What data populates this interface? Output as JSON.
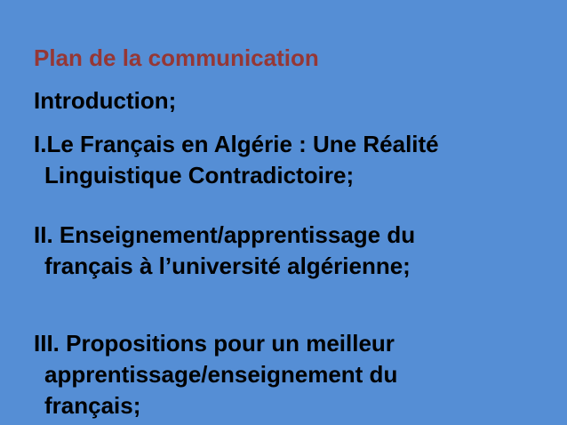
{
  "slide": {
    "title": "Plan de la communication",
    "colors": {
      "background": "#558ed5",
      "title": "#953735",
      "text": "#000000"
    },
    "items": [
      {
        "lines": [
          "Introduction;"
        ]
      },
      {
        "lines": [
          "I.Le Français en Algérie : Une Réalité",
          "Linguistique Contradictoire;"
        ]
      },
      {
        "lines": [
          "II. Enseignement/apprentissage du",
          "français à l’université algérienne;"
        ]
      },
      {
        "lines": [
          "III. Propositions pour un meilleur",
          "apprentissage/enseignement du",
          "français;"
        ]
      }
    ]
  }
}
